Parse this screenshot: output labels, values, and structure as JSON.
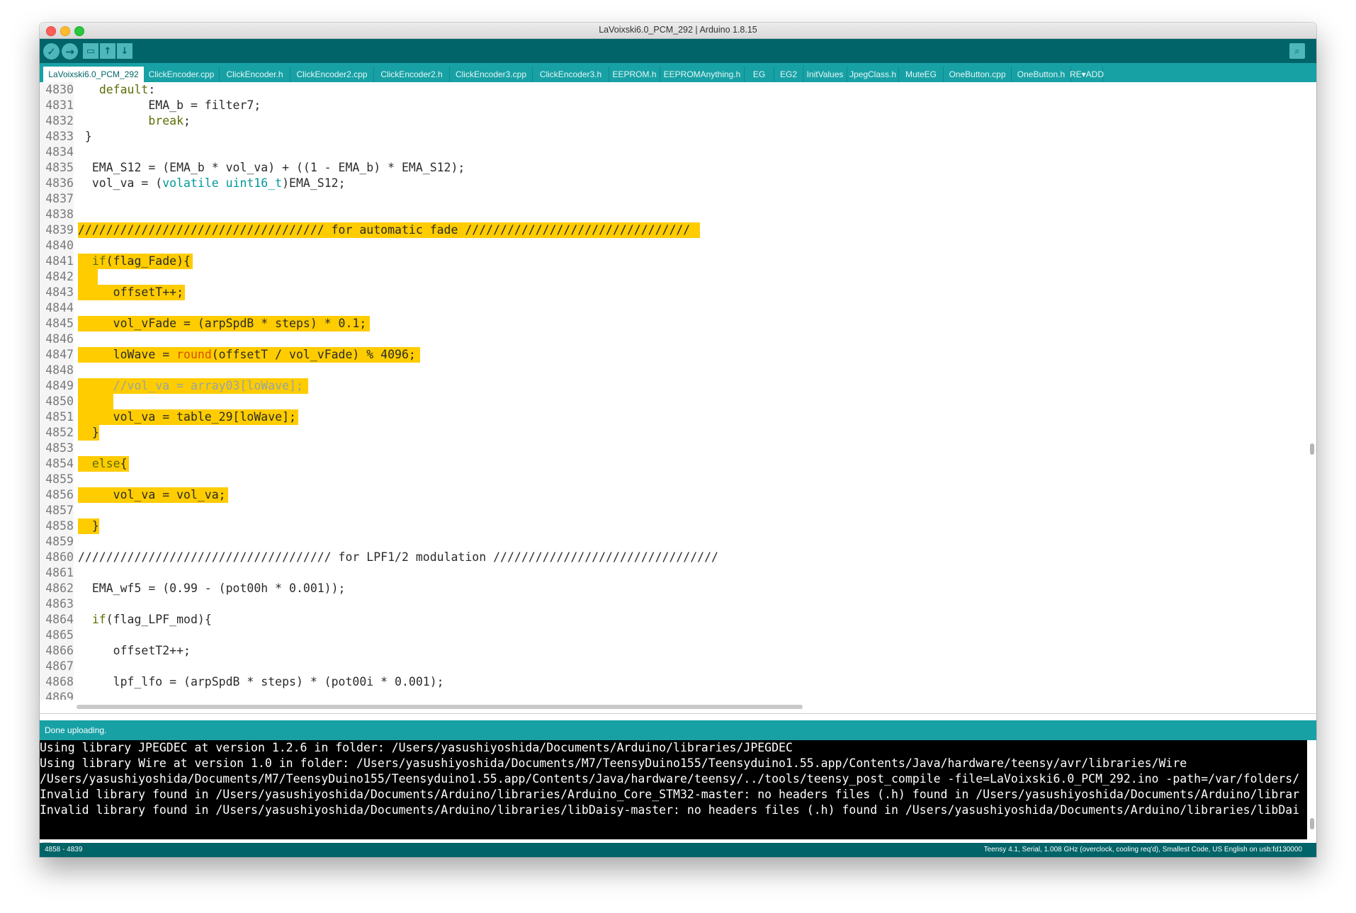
{
  "window": {
    "title": "LaVoixski6.0_PCM_292 | Arduino 1.8.15"
  },
  "toolbar": {
    "verify_icon": "check-icon",
    "upload_icon": "arrow-right-icon",
    "new_icon": "new-file-icon",
    "open_icon": "arrow-up-icon",
    "save_icon": "arrow-down-icon",
    "serial_icon": "magnifier-icon"
  },
  "tabs": [
    {
      "label": "LaVoixski6.0_PCM_292"
    },
    {
      "label": "ClickEncoder.cpp"
    },
    {
      "label": "ClickEncoder.h"
    },
    {
      "label": "ClickEncoder2.cpp"
    },
    {
      "label": "ClickEncoder2.h"
    },
    {
      "label": "ClickEncoder3.cpp"
    },
    {
      "label": "ClickEncoder3.h"
    },
    {
      "label": "EEPROM.h"
    },
    {
      "label": "EEPROMAnything.h"
    },
    {
      "label": "EG"
    },
    {
      "label": "EG2"
    },
    {
      "label": "InitValues"
    },
    {
      "label": "JpegClass.h"
    },
    {
      "label": "MuteEG"
    },
    {
      "label": "OneButton.cpp"
    },
    {
      "label": "OneButton.h"
    },
    {
      "label": "RE▾ADD"
    }
  ],
  "editor": {
    "lines": [
      {
        "n": "4830",
        "t": "   default:"
      },
      {
        "n": "4831",
        "t": "          EMA_b = filter7;"
      },
      {
        "n": "4832",
        "t": "          break;"
      },
      {
        "n": "4833",
        "t": " }"
      },
      {
        "n": "4834",
        "t": ""
      },
      {
        "n": "4835",
        "t": "  EMA_S12 = (EMA_b * vol_va) + ((1 - EMA_b) * EMA_S12);"
      },
      {
        "n": "4836",
        "t": "  vol_va = (volatile uint16_t)EMA_S12;"
      },
      {
        "n": "4837",
        "t": ""
      },
      {
        "n": "4838",
        "t": ""
      },
      {
        "n": "4839",
        "t": "/////////////////////////////////// for automatic fade ////////////////////////////////"
      },
      {
        "n": "4840",
        "t": ""
      },
      {
        "n": "4841",
        "t": "  if(flag_Fade){"
      },
      {
        "n": "4842",
        "t": "   "
      },
      {
        "n": "4843",
        "t": "     offsetT++;"
      },
      {
        "n": "4844",
        "t": ""
      },
      {
        "n": "4845",
        "t": "     vol_vFade = (arpSpdB * steps) * 0.1;"
      },
      {
        "n": "4846",
        "t": ""
      },
      {
        "n": "4847",
        "t": "     loWave = round(offsetT / vol_vFade) % 4096;"
      },
      {
        "n": "4848",
        "t": ""
      },
      {
        "n": "4849",
        "t": "     //vol_va = array03[loWave];"
      },
      {
        "n": "4850",
        "t": "     "
      },
      {
        "n": "4851",
        "t": "     vol_va = table_29[loWave];"
      },
      {
        "n": "4852",
        "t": "  }"
      },
      {
        "n": "4853",
        "t": ""
      },
      {
        "n": "4854",
        "t": "  else{"
      },
      {
        "n": "4855",
        "t": ""
      },
      {
        "n": "4856",
        "t": "     vol_va = vol_va;"
      },
      {
        "n": "4857",
        "t": ""
      },
      {
        "n": "4858",
        "t": "  }"
      },
      {
        "n": "4859",
        "t": ""
      },
      {
        "n": "4860",
        "t": "//////////////////////////////////// for LPF1/2 modulation ////////////////////////////////"
      },
      {
        "n": "4861",
        "t": ""
      },
      {
        "n": "4862",
        "t": "  EMA_wf5 = (0.99 - (pot00h * 0.001));"
      },
      {
        "n": "4863",
        "t": ""
      },
      {
        "n": "4864",
        "t": "  if(flag_LPF_mod){"
      },
      {
        "n": "4865",
        "t": ""
      },
      {
        "n": "4866",
        "t": "     offsetT2++;"
      },
      {
        "n": "4867",
        "t": ""
      },
      {
        "n": "4868",
        "t": "     lpf_lfo = (arpSpdB * steps) * (pot00i * 0.001);"
      },
      {
        "n": "4869",
        "t": ""
      }
    ]
  },
  "status": {
    "message": "Done uploading."
  },
  "console": {
    "lines": [
      "Using library JPEGDEC at version 1.2.6 in folder: /Users/yasushiyoshida/Documents/Arduino/libraries/JPEGDEC",
      "Using library Wire at version 1.0 in folder: /Users/yasushiyoshida/Documents/M7/TeensyDuino155/Teensyduino1.55.app/Contents/Java/hardware/teensy/avr/libraries/Wire",
      "/Users/yasushiyoshida/Documents/M7/TeensyDuino155/Teensyduino1.55.app/Contents/Java/hardware/teensy/../tools/teensy_post_compile -file=LaVoixski6.0_PCM_292.ino -path=/var/folders/",
      "Invalid library found in /Users/yasushiyoshida/Documents/Arduino/libraries/Arduino_Core_STM32-master: no headers files (.h) found in /Users/yasushiyoshida/Documents/Arduino/librar",
      "Invalid library found in /Users/yasushiyoshida/Documents/Arduino/libraries/libDaisy-master: no headers files (.h) found in /Users/yasushiyoshida/Documents/Arduino/libraries/libDai"
    ]
  },
  "footer": {
    "cursor_range": "4858 - 4839",
    "board_info": "Teensy 4.1, Serial, 1.008 GHz (overclock, cooling req'd), Smallest Code, US English on usb:fd130000"
  },
  "colors": {
    "toolbar_bg": "#006468",
    "tab_bg": "#17a1a5",
    "highlight": "#ffcc00"
  }
}
